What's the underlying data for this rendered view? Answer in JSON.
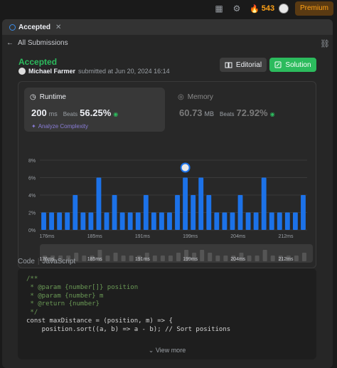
{
  "topbar": {
    "streak_count": "543",
    "premium_label": "Premium",
    "icons": [
      "grid-icon",
      "gear-icon",
      "fire-icon"
    ]
  },
  "tab": {
    "label": "Accepted"
  },
  "nav": {
    "back_label": "All Submissions"
  },
  "submission": {
    "status": "Accepted",
    "user": "Michael Farmer",
    "submitted_text": "submitted at Jun 20, 2024 16:14",
    "editorial_label": "Editorial",
    "solution_label": "Solution"
  },
  "runtime": {
    "label": "Runtime",
    "value": "200",
    "unit": "ms",
    "beats_label": "Beats",
    "beats_pct": "56.25%",
    "analyze_label": "Analyze Complexity"
  },
  "memory": {
    "label": "Memory",
    "value": "60.73",
    "unit": "MB",
    "beats_label": "Beats",
    "beats_pct": "72.92%"
  },
  "chart_data": {
    "type": "bar",
    "y_ticks": [
      "8%",
      "6%",
      "4%",
      "2%",
      "0%"
    ],
    "ylim": [
      0,
      8
    ],
    "x_ticks": [
      "176ms",
      "185ms",
      "191ms",
      "199ms",
      "204ms",
      "212ms"
    ],
    "values": [
      2,
      2,
      2,
      2,
      4,
      2,
      2,
      6,
      2,
      4,
      2,
      2,
      2,
      4,
      2,
      2,
      2,
      4,
      6,
      4,
      6,
      4,
      2,
      2,
      2,
      4,
      2,
      2,
      6,
      2,
      2,
      2,
      2,
      4
    ],
    "highlight_index": 18,
    "bar_color": "#1c72e8"
  },
  "code": {
    "tab_code": "Code",
    "separator": "|",
    "language": "JavaScript",
    "lines": [
      "/**",
      " * @param {number[]} position",
      " * @param {number} m",
      " * @return {number}",
      " */",
      "const maxDistance = (position, m) => {",
      "    position.sort((a, b) => a - b); // Sort positions"
    ],
    "view_more": "View more"
  }
}
